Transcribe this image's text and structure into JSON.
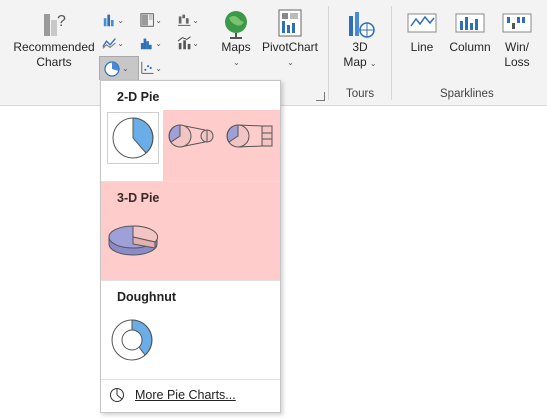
{
  "ribbon": {
    "recommended_charts": {
      "line1": "Recommended",
      "line2": "Charts"
    },
    "maps": {
      "label": "Maps"
    },
    "pivotchart": {
      "label": "PivotChart"
    },
    "map3d": {
      "line1": "3D",
      "line2": "Map"
    },
    "tours_group": "Tours",
    "sparklines": {
      "line": "Line",
      "column": "Column",
      "winloss_line1": "Win/",
      "winloss_line2": "Loss",
      "group": "Sparklines"
    }
  },
  "pie_menu": {
    "sections": {
      "pie2d": "2-D Pie",
      "pie3d": "3-D Pie",
      "doughnut": "Doughnut"
    },
    "more_label": "More Pie Charts...",
    "highlight_color": "#ffcccc"
  },
  "colors": {
    "pie_blue": "#6aaee8",
    "pie_purple": "#9fa0d8",
    "pie_pink": "#f2c4c4"
  }
}
